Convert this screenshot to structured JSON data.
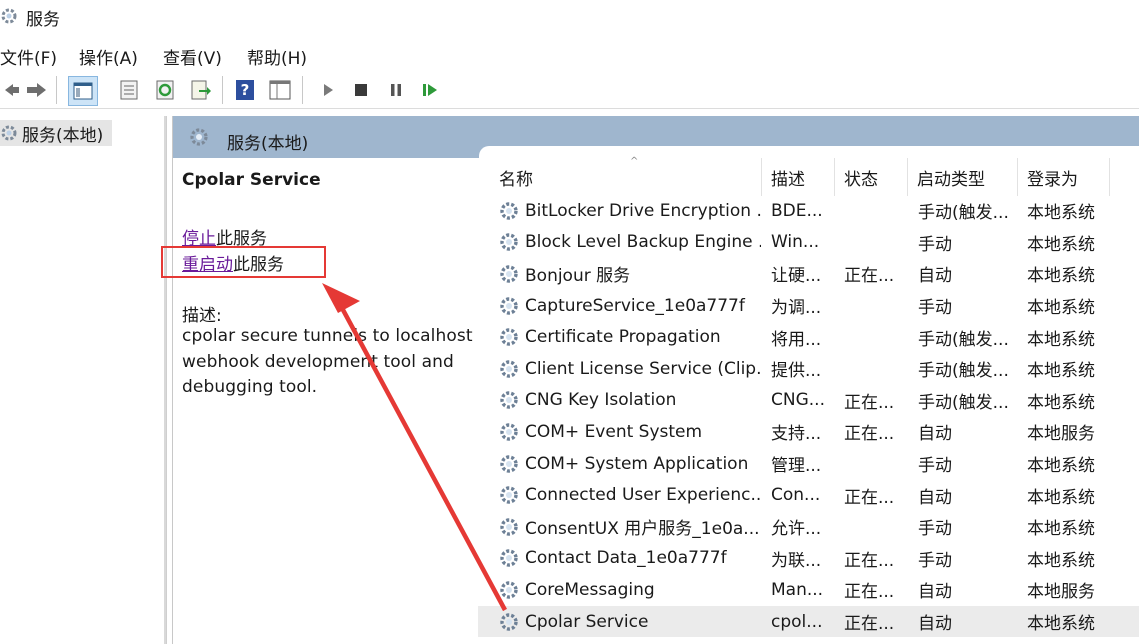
{
  "window": {
    "title": "服务"
  },
  "menu": [
    "文件(F)",
    "操作(A)",
    "查看(V)",
    "帮助(H)"
  ],
  "toolbar": [
    "back-icon",
    "forward-icon",
    "console-tree-icon",
    "properties-icon",
    "refresh-icon",
    "export-icon",
    "help-icon",
    "view-icon",
    "start-icon",
    "stop-icon",
    "pause-icon",
    "restart-icon"
  ],
  "tree": {
    "root": "服务(本地)"
  },
  "panel": {
    "header": "服务(本地)",
    "service_title": "Cpolar Service",
    "stop_link": "停止",
    "stop_rest": "此服务",
    "restart_link": "重启动",
    "restart_rest": "此服务",
    "desc_label": "描述:",
    "desc_text": "cpolar secure tunnels to localhost webhook development tool and debugging tool."
  },
  "table": {
    "headers": [
      "名称",
      "描述",
      "状态",
      "启动类型",
      "登录为"
    ],
    "rows": [
      {
        "name": "BitLocker Drive Encryption ...",
        "desc": "BDE...",
        "state": "",
        "start": "手动(触发...",
        "logon": "本地系统"
      },
      {
        "name": "Block Level Backup Engine ...",
        "desc": "Win...",
        "state": "",
        "start": "手动",
        "logon": "本地系统"
      },
      {
        "name": "Bonjour 服务",
        "desc": "让硬...",
        "state": "正在...",
        "start": "自动",
        "logon": "本地系统"
      },
      {
        "name": "CaptureService_1e0a777f",
        "desc": "为调...",
        "state": "",
        "start": "手动",
        "logon": "本地系统"
      },
      {
        "name": "Certificate Propagation",
        "desc": "将用...",
        "state": "",
        "start": "手动(触发...",
        "logon": "本地系统"
      },
      {
        "name": "Client License Service (Clip...",
        "desc": "提供...",
        "state": "",
        "start": "手动(触发...",
        "logon": "本地系统"
      },
      {
        "name": "CNG Key Isolation",
        "desc": "CNG...",
        "state": "正在...",
        "start": "手动(触发...",
        "logon": "本地系统"
      },
      {
        "name": "COM+ Event System",
        "desc": "支持...",
        "state": "正在...",
        "start": "自动",
        "logon": "本地服务"
      },
      {
        "name": "COM+ System Application",
        "desc": "管理...",
        "state": "",
        "start": "手动",
        "logon": "本地系统"
      },
      {
        "name": "Connected User Experienc...",
        "desc": "Con...",
        "state": "正在...",
        "start": "自动",
        "logon": "本地系统"
      },
      {
        "name": "ConsentUX 用户服务_1e0a...",
        "desc": "允许...",
        "state": "",
        "start": "手动",
        "logon": "本地系统"
      },
      {
        "name": "Contact Data_1e0a777f",
        "desc": "为联...",
        "state": "正在...",
        "start": "手动",
        "logon": "本地系统"
      },
      {
        "name": "CoreMessaging",
        "desc": "Man...",
        "state": "正在...",
        "start": "自动",
        "logon": "本地服务"
      },
      {
        "name": "Cpolar Service",
        "desc": "cpol...",
        "state": "正在...",
        "start": "自动",
        "logon": "本地系统",
        "selected": true
      }
    ]
  },
  "colors": {
    "accent": "#9fb6ce",
    "highlight": "#e53935",
    "link": "#6a1b9a"
  }
}
